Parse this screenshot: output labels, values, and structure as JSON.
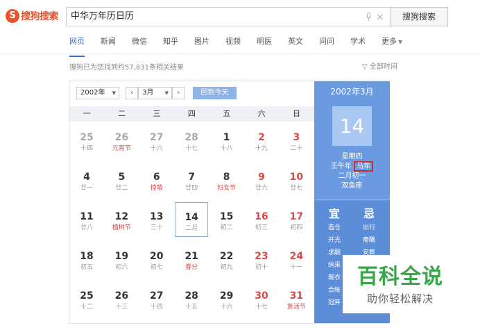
{
  "logo": {
    "mark": "S",
    "text": "搜狗搜索"
  },
  "search": {
    "query": "中华万年历日历",
    "button": "搜狗搜索"
  },
  "tabs": [
    {
      "label": "网页",
      "active": true
    },
    {
      "label": "新闻"
    },
    {
      "label": "微信"
    },
    {
      "label": "知乎"
    },
    {
      "label": "图片"
    },
    {
      "label": "视频"
    },
    {
      "label": "明医"
    },
    {
      "label": "英文"
    },
    {
      "label": "问问"
    },
    {
      "label": "学术"
    },
    {
      "label": "更多"
    }
  ],
  "results": {
    "count_text": "搜狗已为您找到约57,831条相关结果",
    "time_filter": "全部时间"
  },
  "calendar": {
    "year_select": "2002年",
    "month_select": "3月",
    "today_button": "回到今天",
    "weekdays": [
      "一",
      "二",
      "三",
      "四",
      "五",
      "六",
      "日"
    ],
    "weeks": [
      [
        {
          "d": "25",
          "l": "十四",
          "other": true
        },
        {
          "d": "26",
          "l": "元宵节",
          "other": true,
          "fest": true
        },
        {
          "d": "27",
          "l": "十六",
          "other": true
        },
        {
          "d": "28",
          "l": "十七",
          "other": true
        },
        {
          "d": "1",
          "l": "十八"
        },
        {
          "d": "2",
          "l": "十九",
          "weekend": true
        },
        {
          "d": "3",
          "l": "二十",
          "weekend": true
        }
      ],
      [
        {
          "d": "4",
          "l": "廿一"
        },
        {
          "d": "5",
          "l": "廿二"
        },
        {
          "d": "6",
          "l": "惊蛰",
          "fest": true
        },
        {
          "d": "7",
          "l": "廿四"
        },
        {
          "d": "8",
          "l": "妇女节",
          "fest": true
        },
        {
          "d": "9",
          "l": "廿六",
          "weekend": true
        },
        {
          "d": "10",
          "l": "廿七",
          "weekend": true
        }
      ],
      [
        {
          "d": "11",
          "l": "廿八"
        },
        {
          "d": "12",
          "l": "植树节",
          "fest": true
        },
        {
          "d": "13",
          "l": "三十"
        },
        {
          "d": "14",
          "l": "二月",
          "today": true
        },
        {
          "d": "15",
          "l": "初二"
        },
        {
          "d": "16",
          "l": "初三",
          "weekend": true
        },
        {
          "d": "17",
          "l": "初四",
          "weekend": true
        }
      ],
      [
        {
          "d": "18",
          "l": "初五"
        },
        {
          "d": "19",
          "l": "初六"
        },
        {
          "d": "20",
          "l": "初七"
        },
        {
          "d": "21",
          "l": "春分",
          "fest": true
        },
        {
          "d": "22",
          "l": "初九"
        },
        {
          "d": "23",
          "l": "初十",
          "weekend": true
        },
        {
          "d": "24",
          "l": "十一",
          "weekend": true
        }
      ],
      [
        {
          "d": "25",
          "l": "十二"
        },
        {
          "d": "26",
          "l": "十三"
        },
        {
          "d": "27",
          "l": "十四"
        },
        {
          "d": "28",
          "l": "十五"
        },
        {
          "d": "29",
          "l": "十六"
        },
        {
          "d": "30",
          "l": "十七",
          "weekend": true
        },
        {
          "d": "31",
          "l": "复活节",
          "weekend": true,
          "fest": true
        }
      ]
    ]
  },
  "side": {
    "header": "2002年3月",
    "day": "14",
    "weekday": "星期四",
    "ganzhi_prefix": "壬午年",
    "zodiac": "马年",
    "lunar": "二月初一",
    "constellation": "双鱼座",
    "yi_title": "宜",
    "ji_title": "忌",
    "yi": [
      "造仓",
      "开光",
      "求嗣",
      "纳采",
      "裁衣",
      "合帐",
      "冠笄"
    ],
    "ji": [
      "出行",
      "斋醮",
      "安葬"
    ]
  },
  "watermark": {
    "title": "百科全说",
    "subtitle": "助你轻松解决"
  },
  "colors": {
    "accent": "#3d6dc6",
    "panel": "#6a9ae0",
    "weekend": "#d74a46",
    "watermark": "#39a649"
  }
}
